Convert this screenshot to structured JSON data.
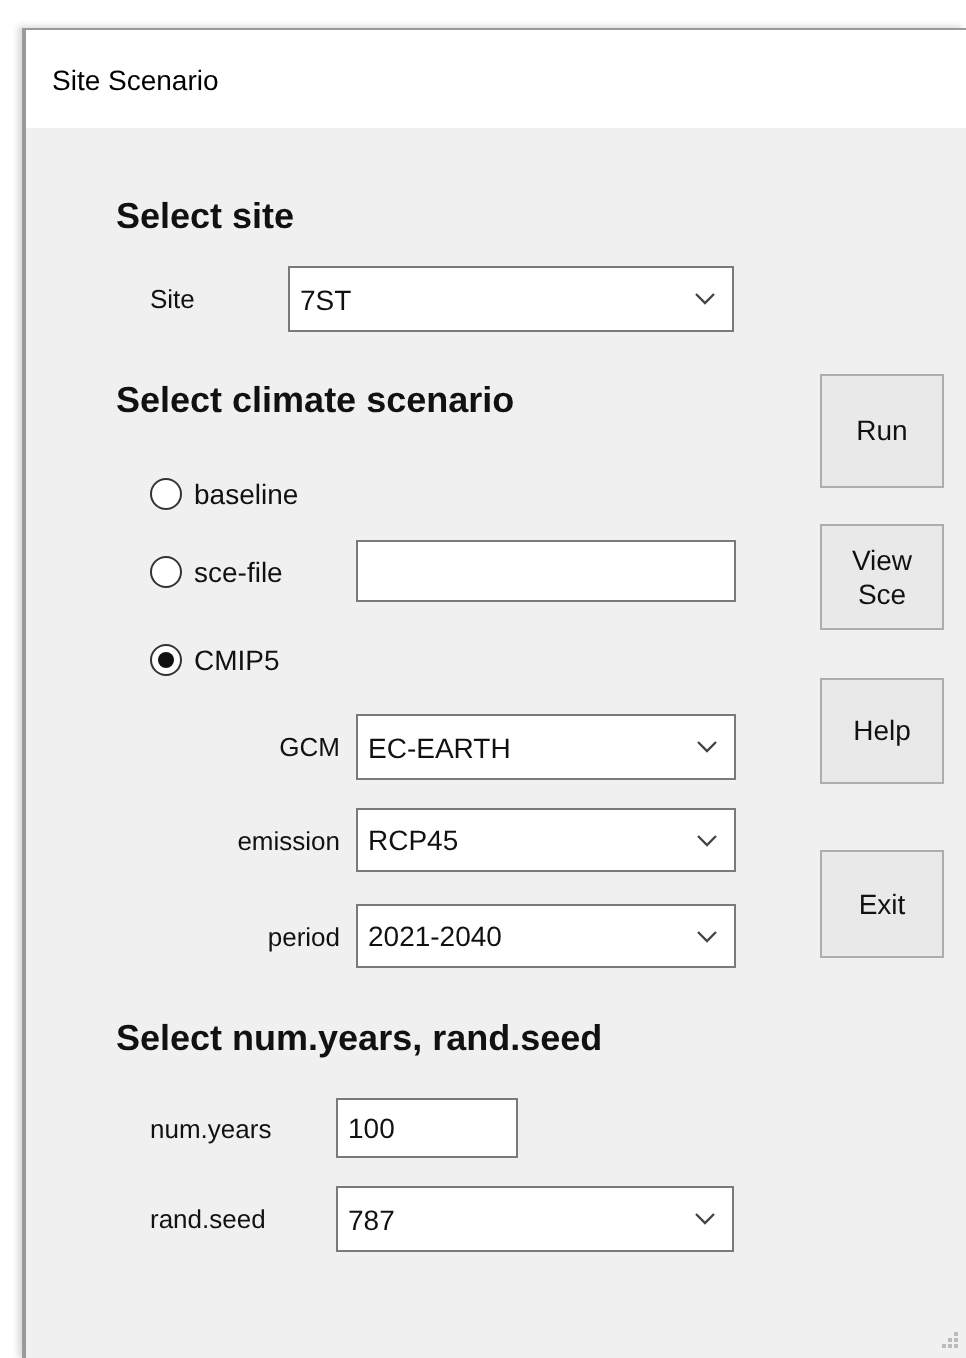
{
  "window": {
    "title": "Site Scenario"
  },
  "site_section": {
    "heading": "Select site",
    "site": {
      "label": "Site",
      "value": "7ST"
    }
  },
  "climate_section": {
    "heading": "Select climate scenario",
    "options": [
      {
        "label": "baseline",
        "selected": false
      },
      {
        "label": "sce-file",
        "selected": false,
        "kind": "file"
      },
      {
        "label": "CMIP5",
        "selected": true
      }
    ],
    "cmip5_fields": [
      {
        "label": "GCM",
        "value": "EC-EARTH"
      },
      {
        "label": "emission",
        "value": "RCP45"
      },
      {
        "label": "period",
        "value": "2021-2040"
      }
    ]
  },
  "years_section": {
    "heading": "Select num.years, rand.seed",
    "fields": [
      {
        "kind": "text",
        "label": "num.years",
        "value": "100"
      },
      {
        "kind": "combo",
        "label": "rand.seed",
        "value": "787"
      }
    ]
  },
  "buttons": [
    "Run",
    "View Sce",
    "Help",
    "Exit"
  ]
}
